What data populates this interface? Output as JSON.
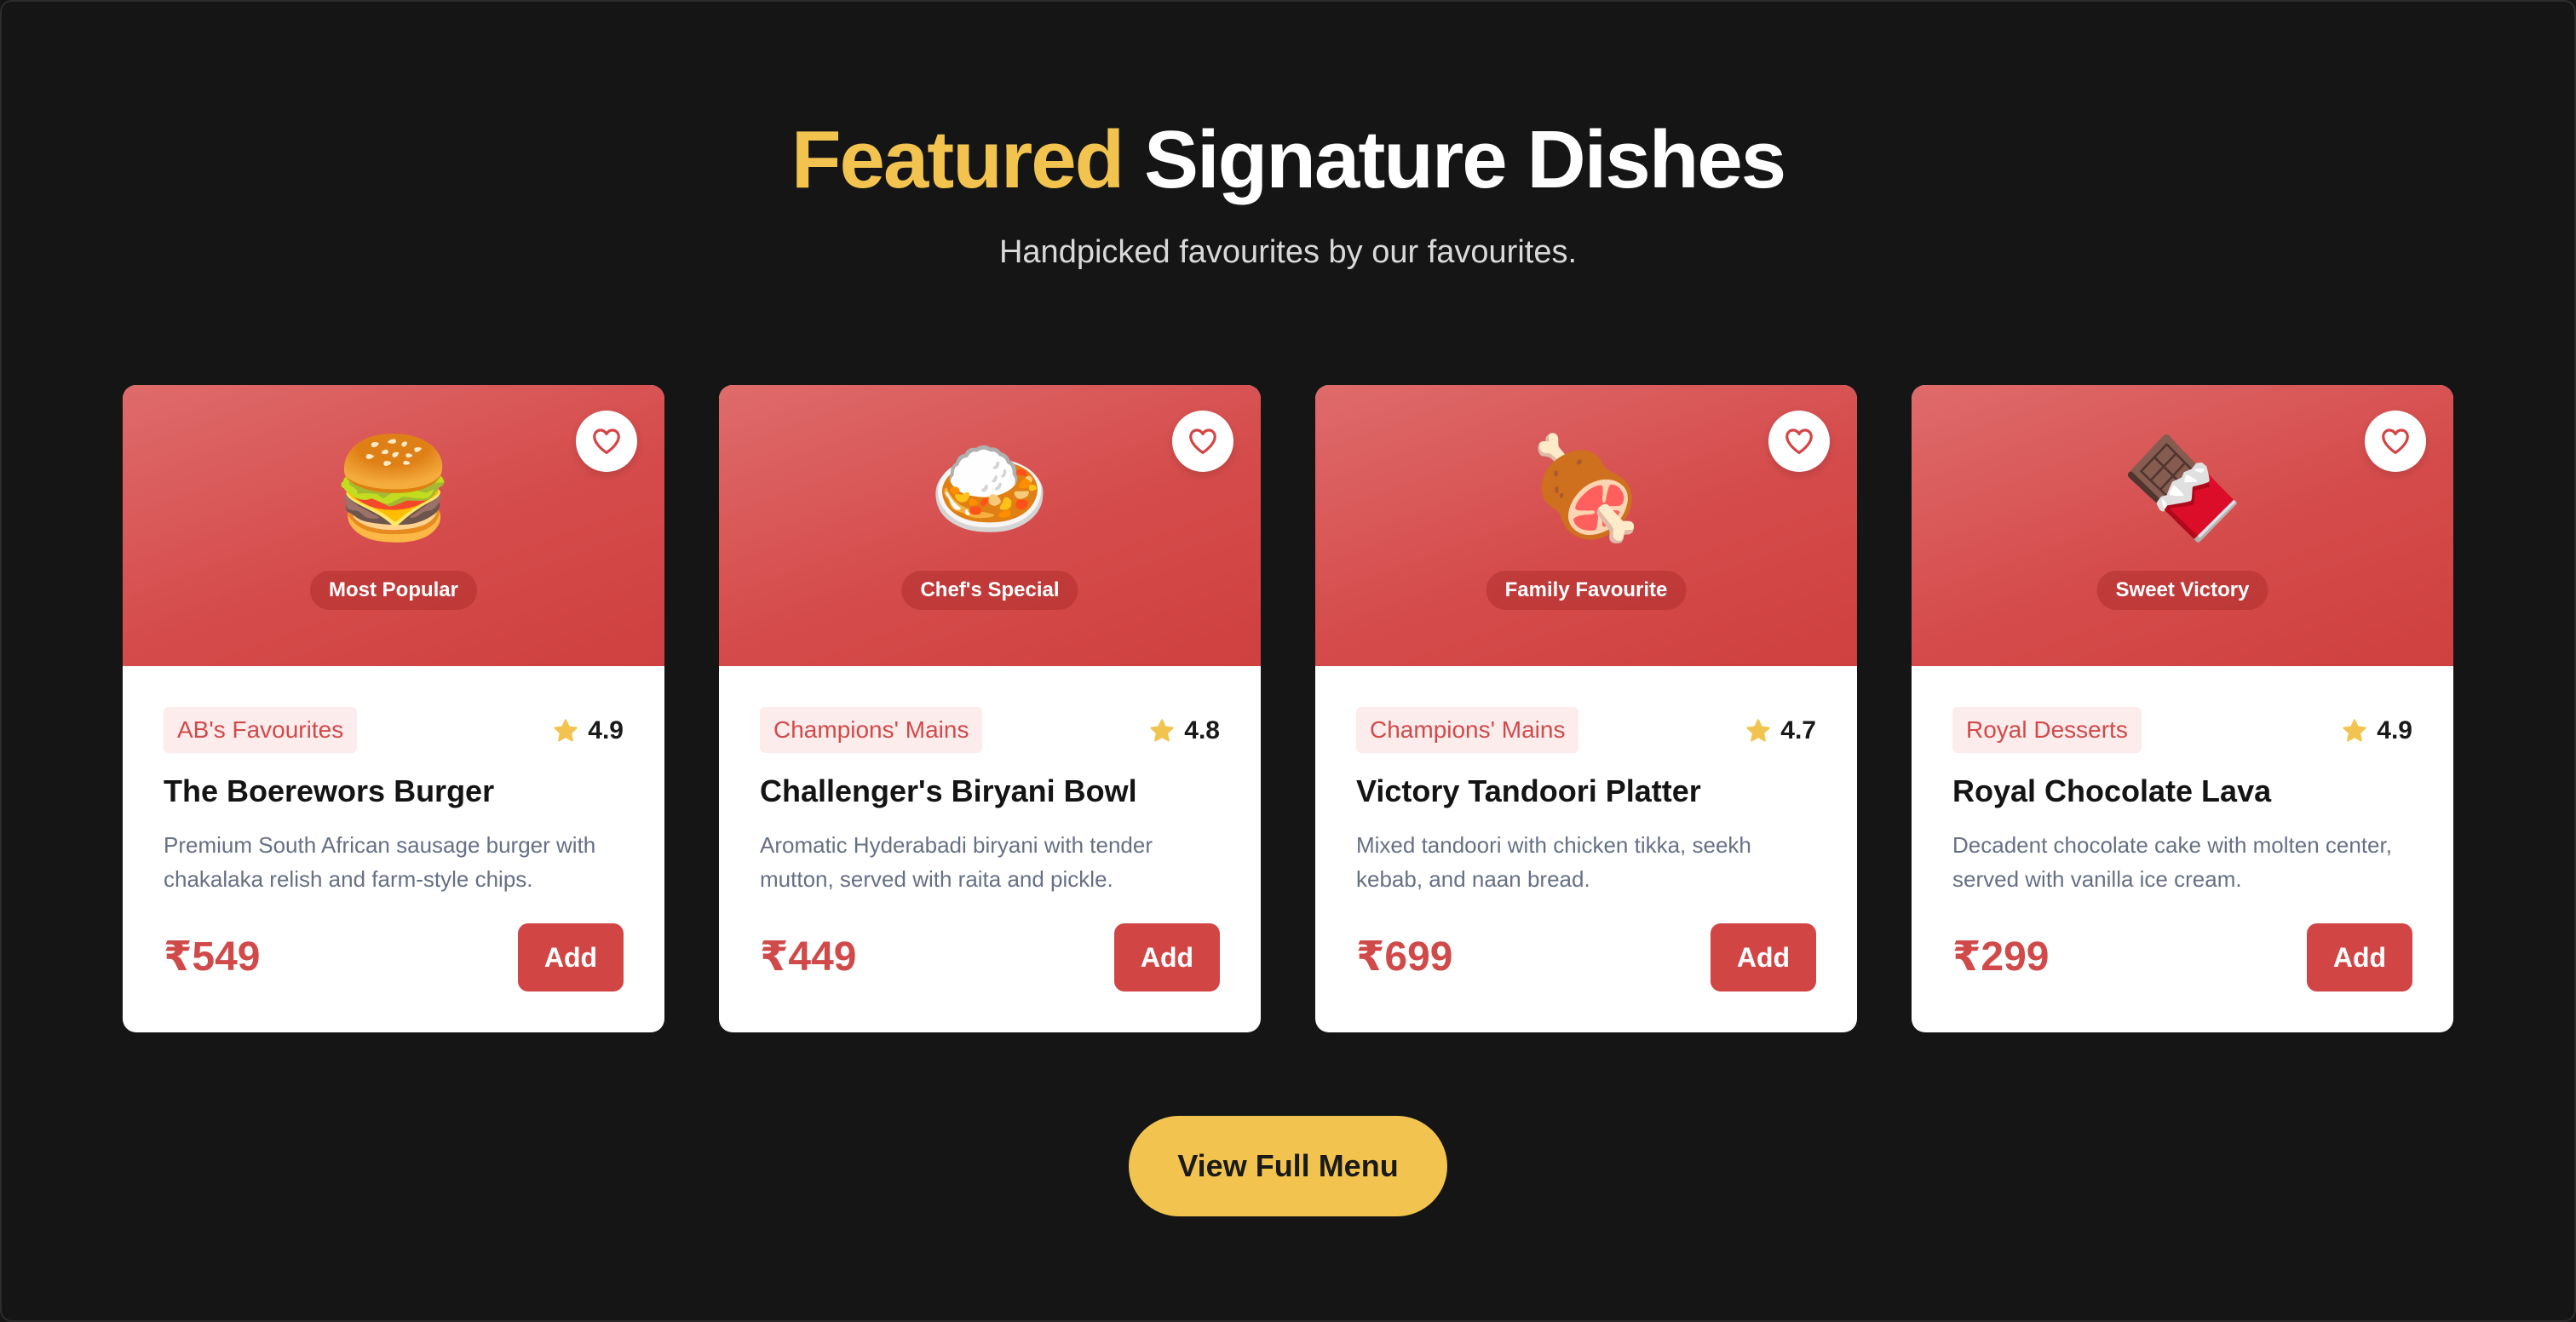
{
  "section": {
    "title_accent": "Featured",
    "title_rest": "Signature Dishes",
    "subtitle": "Handpicked favourites by our favourites."
  },
  "colors": {
    "background": "#151515",
    "accent_yellow": "#f2c44f",
    "card_red": "#d54b4b",
    "price_red": "#d04a4a",
    "category_bg": "#fdecec",
    "star": "#f2c44f"
  },
  "dishes": [
    {
      "emoji": "🍔",
      "badge": "Most Popular",
      "category": "AB's Favourites",
      "rating": "4.9",
      "name": "The Boerewors Burger",
      "description": "Premium South African sausage burger with chakalaka relish and farm-style chips.",
      "price": "₹549",
      "add_label": "Add",
      "icon": "heart-icon"
    },
    {
      "emoji": "🍛",
      "badge": "Chef's Special",
      "category": "Champions' Mains",
      "rating": "4.8",
      "name": "Challenger's Biryani Bowl",
      "description": "Aromatic Hyderabadi biryani with tender mutton, served with raita and pickle.",
      "price": "₹449",
      "add_label": "Add",
      "icon": "heart-icon"
    },
    {
      "emoji": "🍖",
      "badge": "Family Favourite",
      "category": "Champions' Mains",
      "rating": "4.7",
      "name": "Victory Tandoori Platter",
      "description": "Mixed tandoori with chicken tikka, seekh kebab, and naan bread.",
      "price": "₹699",
      "add_label": "Add",
      "icon": "heart-icon"
    },
    {
      "emoji": "🍫",
      "badge": "Sweet Victory",
      "category": "Royal Desserts",
      "rating": "4.9",
      "name": "Royal Chocolate Lava",
      "description": "Decadent chocolate cake with molten center, served with vanilla ice cream.",
      "price": "₹299",
      "add_label": "Add",
      "icon": "heart-icon"
    }
  ],
  "view_menu_label": "View Full Menu"
}
